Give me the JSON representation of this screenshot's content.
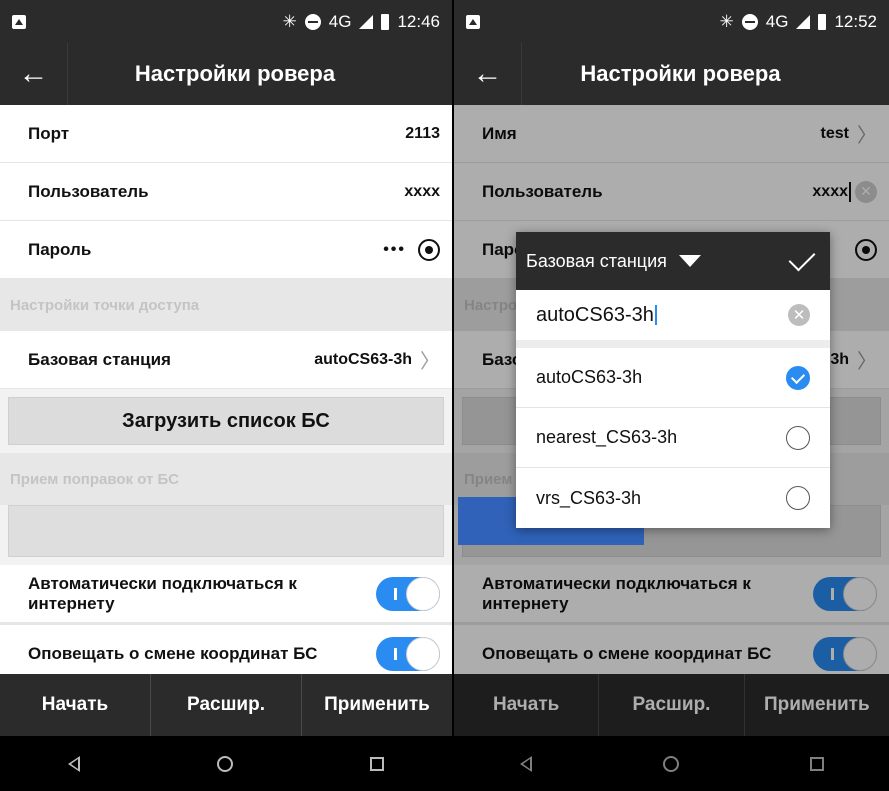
{
  "left": {
    "status": {
      "indicators": "✳",
      "net": "4G",
      "time": "12:46"
    },
    "title": "Настройки ровера",
    "rows": [
      {
        "label": "Порт",
        "value": "2113"
      },
      {
        "label": "Пользователь",
        "value": "xxxx"
      },
      {
        "label": "Пароль",
        "value": "•••"
      }
    ],
    "section_access": "Настройки точки доступа",
    "base_station": {
      "label": "Базовая станция",
      "value": "autoCS63-3h"
    },
    "load_button": "Загрузить список БС",
    "section_corrections": "Прием поправок от БС",
    "toggle_internet": "Автоматически подключаться к интернету",
    "toggle_notify": "Оповещать о смене координат БС",
    "bottom": {
      "start": "Начать",
      "advanced": "Расшир.",
      "apply": "Применить"
    }
  },
  "right": {
    "status": {
      "indicators": "✳",
      "net": "4G",
      "time": "12:52"
    },
    "title": "Настройки ровера",
    "rows": [
      {
        "label": "Имя",
        "value": "test"
      },
      {
        "label": "Пользователь",
        "value": "xxxx"
      },
      {
        "label": "Паро",
        "value": ""
      }
    ],
    "section_access": "Настро",
    "base_station": {
      "label": "Базо",
      "value": "3h"
    },
    "section_corrections": "Прием",
    "toggle_internet": "Автоматически подключаться к интернету",
    "toggle_notify": "Оповещать о смене координат БС",
    "bottom": {
      "start": "Начать",
      "advanced": "Расшир.",
      "apply": "Применить"
    },
    "dialog": {
      "title": "Базовая станция",
      "input_value": "autoCS63-3h",
      "options": [
        {
          "label": "autoCS63-3h",
          "selected": true
        },
        {
          "label": "nearest_CS63-3h",
          "selected": false
        },
        {
          "label": "vrs_CS63-3h",
          "selected": false
        }
      ]
    }
  },
  "colors": {
    "accent": "#2a8bf1",
    "bar": "#2b2b2b"
  }
}
